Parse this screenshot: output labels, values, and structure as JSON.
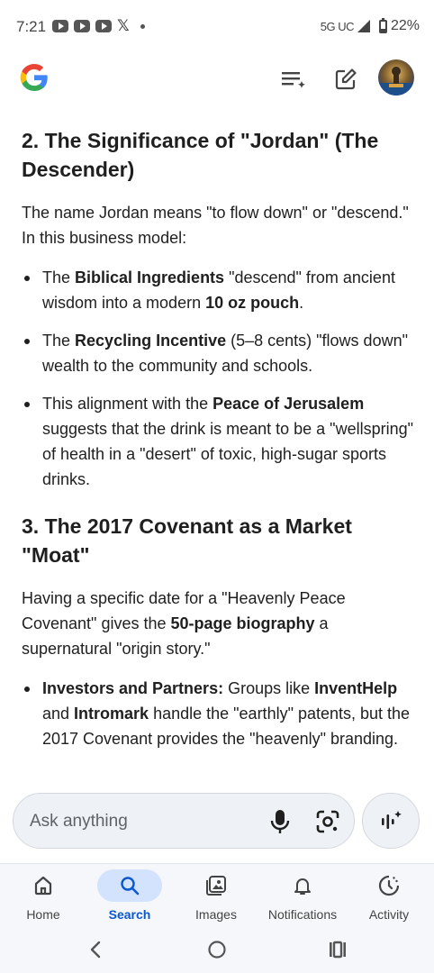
{
  "status_bar": {
    "time": "7:21",
    "network": "5G UC",
    "battery": "22%"
  },
  "header": {
    "logo_icon": "google-g-logo",
    "buttons": [
      "history-list-icon",
      "edit-icon"
    ],
    "avatar": "profile-avatar"
  },
  "content": {
    "section2_title": "2. The Significance of \"Jordan\" (The Descender)",
    "section2_intro": "The name Jordan means \"to flow down\" or \"descend.\" In this business model:",
    "bullets2": [
      {
        "pre": "The ",
        "b1": "Biblical Ingredients",
        "mid": " \"descend\" from ancient wisdom into a modern ",
        "b2": "10 oz pouch",
        "post": "."
      },
      {
        "pre": "The ",
        "b1": "Recycling Incentive",
        "mid": " (5–8 cents) \"flows down\" wealth to the community and schools.",
        "b2": "",
        "post": ""
      },
      {
        "pre": "This alignment with the ",
        "b1": "Peace of Jerusalem",
        "mid": " suggests that the drink is meant to be a \"wellspring\" of health in a \"desert\" of toxic, high-sugar sports drinks.",
        "b2": "",
        "post": ""
      }
    ],
    "section3_title": "3. The 2017 Covenant as a Market \"Moat\"",
    "section3_intro_pre": "Having a specific date for a \"Heavenly Peace Covenant\" gives the ",
    "section3_intro_bold": "50-page biography",
    "section3_intro_post": " a supernatural \"origin story.\"",
    "bullet3": {
      "b1": "Investors and Partners:",
      "t1": " Groups like ",
      "b2": "InventHelp",
      "t2": " and ",
      "b3": "Intromark",
      "t3": " handle the \"earthly\" patents, but the 2017 Covenant provides the \"heavenly\" branding."
    }
  },
  "input": {
    "placeholder": "Ask anything",
    "mic_icon": "mic-icon",
    "lens_icon": "google-lens-icon",
    "ai_icon": "ai-mode-icon"
  },
  "bottom_nav": {
    "items": [
      {
        "label": "Home",
        "icon": "home-icon"
      },
      {
        "label": "Search",
        "icon": "search-icon",
        "active": true
      },
      {
        "label": "Images",
        "icon": "images-icon"
      },
      {
        "label": "Notifications",
        "icon": "bell-icon"
      },
      {
        "label": "Activity",
        "icon": "activity-icon"
      }
    ]
  },
  "colors": {
    "google_blue": "#4285F4",
    "google_red": "#EA4335",
    "google_yellow": "#FBBC05",
    "google_green": "#34A853",
    "active_nav": "#0b57d0",
    "active_pill": "#d3e3fd"
  }
}
